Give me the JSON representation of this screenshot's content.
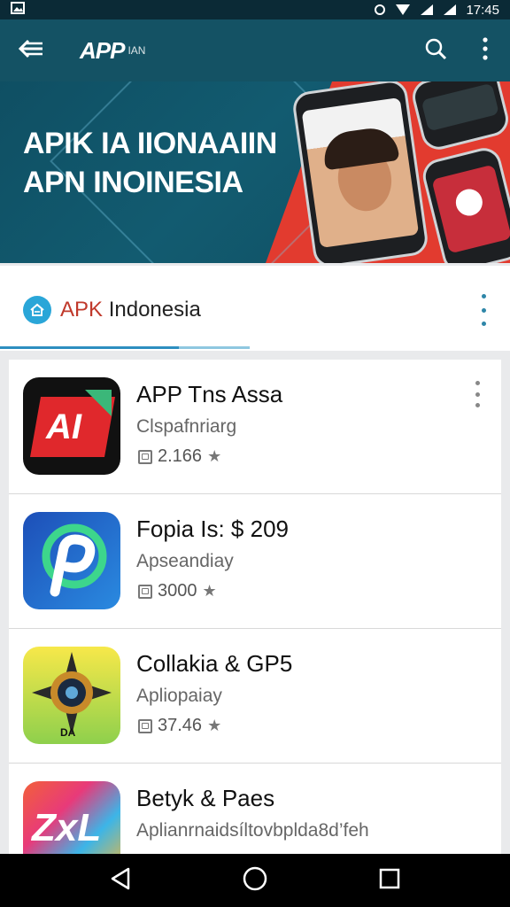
{
  "status_bar": {
    "time": "17:45"
  },
  "app_bar": {
    "logo": "APP",
    "logo_sub": "IAN"
  },
  "banner": {
    "line1": "APIK IA IIONAAIIN",
    "line2": "APN INOINESIA"
  },
  "section": {
    "brand": "APK",
    "title_rest": " Indonesia"
  },
  "apps": [
    {
      "name": "APP Tns Assa",
      "subtitle": "Clspafnriarg",
      "meta": "2.166"
    },
    {
      "name": "Fopia Is: $ 209",
      "subtitle": "Apseandiay",
      "meta": "3000"
    },
    {
      "name": "Collakia & GP5",
      "subtitle": "Apliopaiay",
      "meta": "37.46"
    },
    {
      "name": "Betyk & Paes",
      "subtitle": "Aplianrnaidsíltovbplda8d’feh",
      "meta": ""
    }
  ],
  "icon_labels": {
    "app1": "AI",
    "app4": "ZxL",
    "app3": "DA"
  },
  "colors": {
    "app_bar": "#145264",
    "banner_red": "#e23b2f",
    "accent": "#2d8fc0"
  }
}
